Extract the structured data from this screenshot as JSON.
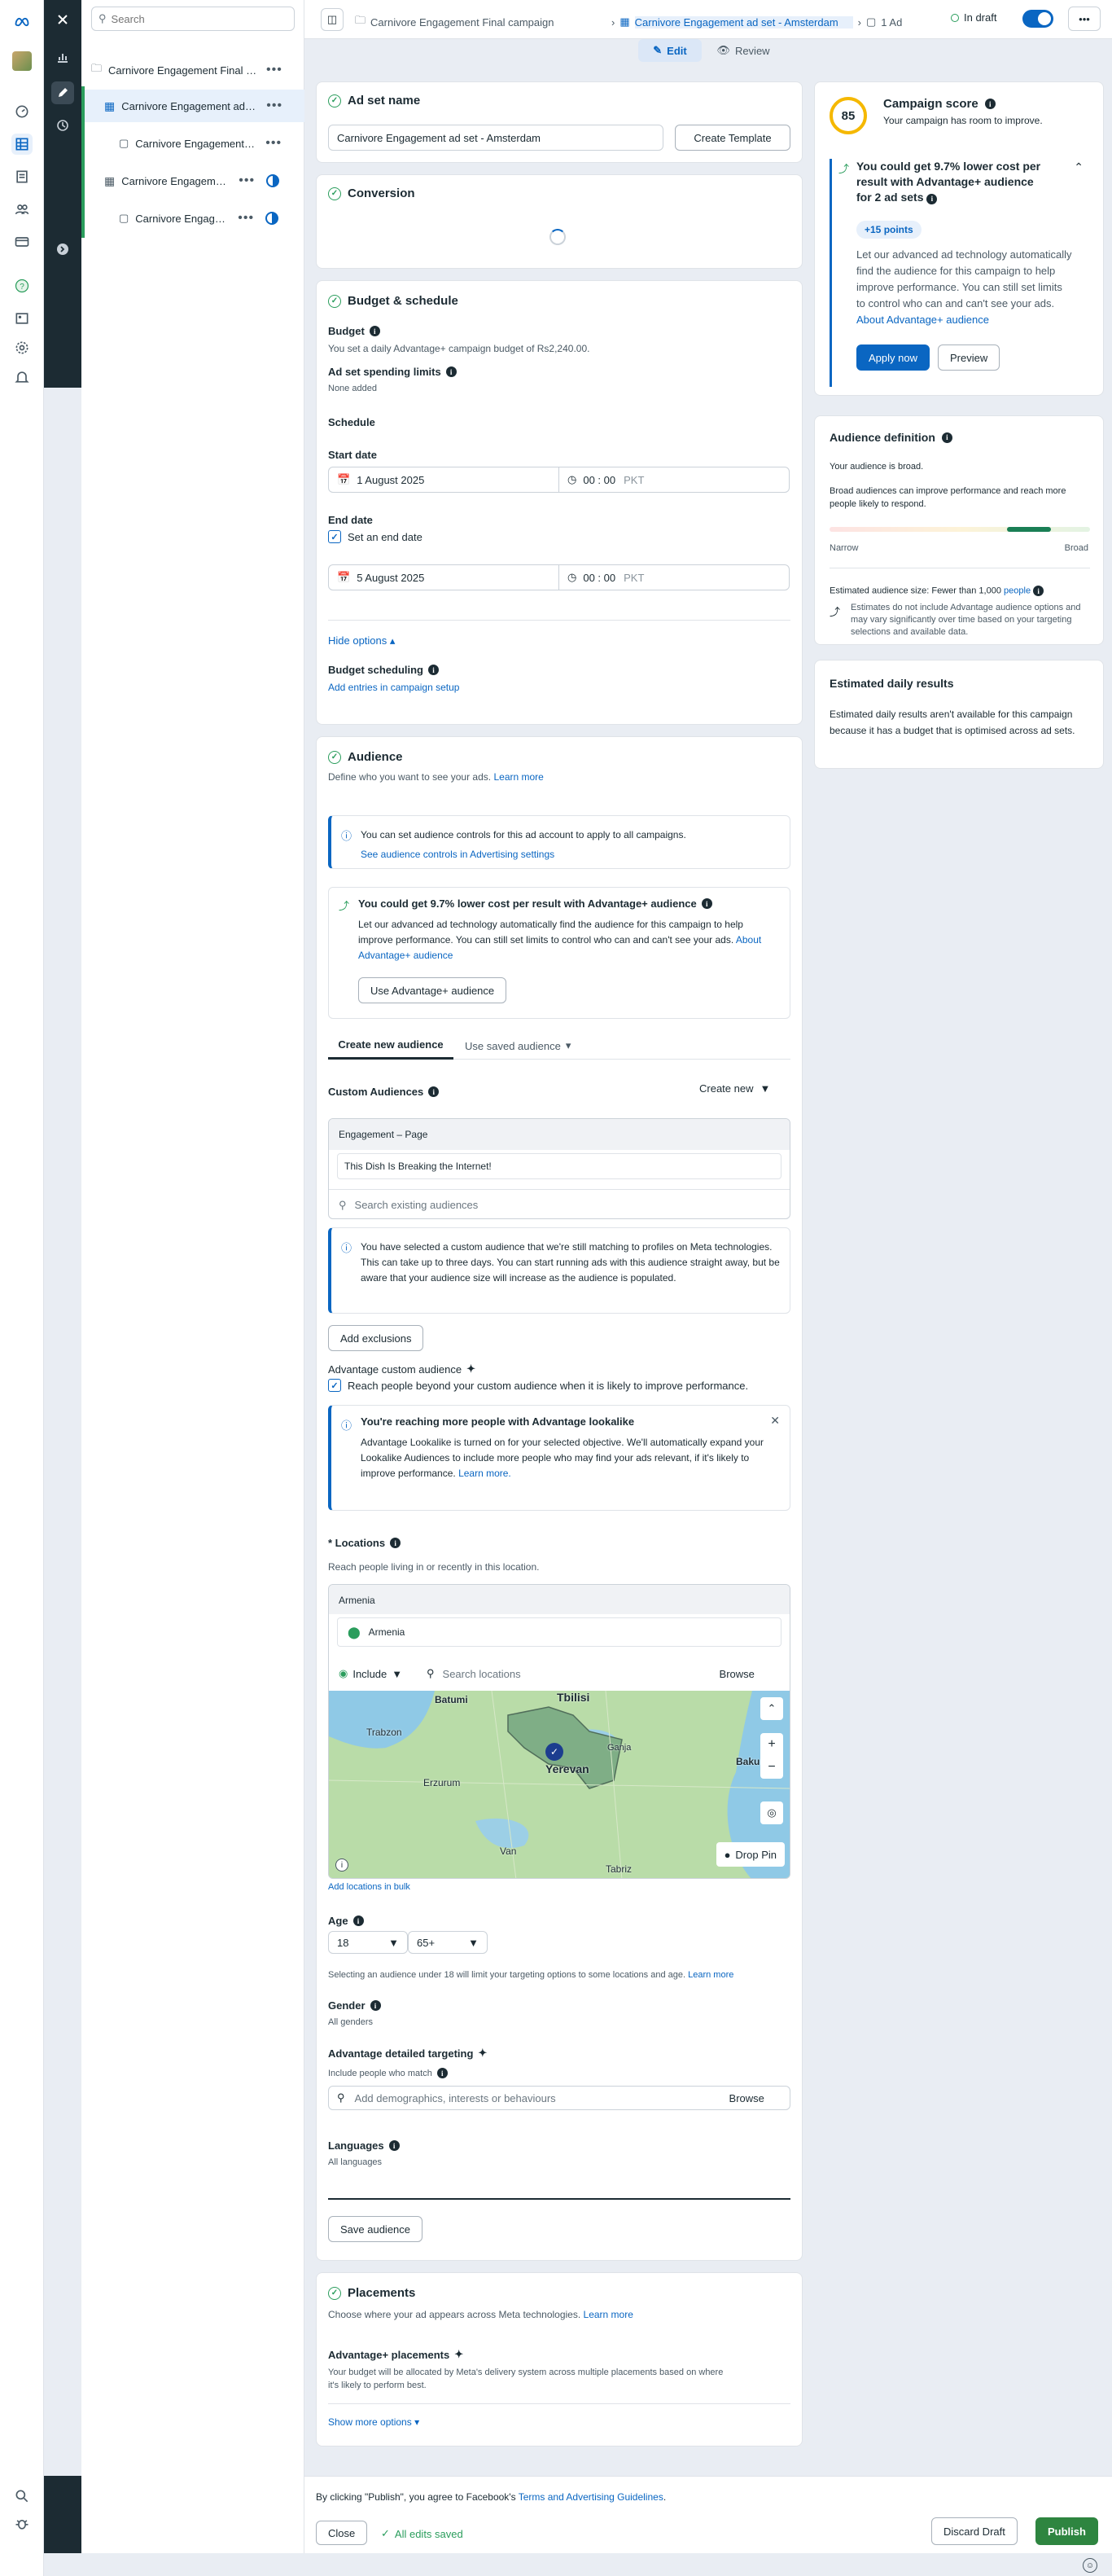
{
  "tree": {
    "search_placeholder": "Search",
    "campaign": "Carnivore Engagement Final campaign",
    "adset": "Carnivore Engagement ad set - Amsterdam",
    "ad1": "Carnivore Engagement ad",
    "adset2": "Carnivore Engagement ad set",
    "ad2": "Carnivore Engagement ad"
  },
  "topbar": {
    "crumb1": "Carnivore Engagement Final campaign",
    "crumb2": "Carnivore Engagement ad set - Amsterdam",
    "crumb3": "1 Ad",
    "status": "In draft",
    "edit": "Edit",
    "review": "Review"
  },
  "adset_name": {
    "title": "Ad set name",
    "value": "Carnivore Engagement ad set - Amsterdam",
    "create_template": "Create Template"
  },
  "conversion": {
    "title": "Conversion"
  },
  "budget": {
    "title": "Budget & schedule",
    "budget_label": "Budget",
    "budget_text": "You set a daily Advantage+ campaign budget of Rs2,240.00.",
    "spending_label": "Ad set spending limits",
    "spending_value": "None added",
    "schedule": "Schedule",
    "start_label": "Start date",
    "start_date": "1 August 2025",
    "start_time": "00 : 00",
    "tz": "PKT",
    "end_label": "End date",
    "set_end": "Set an end date",
    "end_date": "5 August 2025",
    "end_time": "00 : 00",
    "hide_options": "Hide options",
    "sched_label": "Budget scheduling",
    "sched_link": "Add entries in campaign setup"
  },
  "audience": {
    "title": "Audience",
    "subtitle": "Define who you want to see your ads.",
    "learn_more": "Learn more",
    "controls_info": "You can set audience controls for this ad account to apply to all campaigns.",
    "controls_link": "See audience controls in Advertising settings",
    "adv_title": "You could get 9.7% lower cost per result with Advantage+ audience",
    "adv_body": "Let our advanced ad technology automatically find the audience for this campaign to help improve performance. You can still set limits to control who can and can't see your ads.",
    "adv_link": "About Advantage+ audience",
    "use_adv": "Use Advantage+ audience",
    "tab1": "Create new audience",
    "tab2": "Use saved audience",
    "custom_label": "Custom Audiences",
    "create_new": "Create new",
    "eng_header": "Engagement – Page",
    "eng_item": "This Dish Is Breaking the Internet!",
    "search_existing": "Search existing audiences",
    "matching_info": "You have selected a custom audience that we're still matching to profiles on Meta technologies. This can take up to three days. You can start running ads with this audience straight away, but be aware that your audience size will increase as the audience is populated.",
    "add_exclusions": "Add exclusions",
    "adv_custom": "Advantage custom audience",
    "reach_beyond": "Reach people beyond your custom audience when it is likely to improve performance.",
    "lookalike_title": "You're reaching more people with Advantage lookalike",
    "lookalike_body": "Advantage Lookalike is turned on for your selected objective. We'll automatically expand your Lookalike Audiences to include more people who may find your ads relevant, if it's likely to improve performance.",
    "lookalike_link": "Learn more.",
    "locations_label": "* Locations",
    "locations_sub": "Reach people living in or recently in this location.",
    "loc_header": "Armenia",
    "loc_item": "Armenia",
    "include": "Include",
    "search_locations": "Search locations",
    "browse": "Browse",
    "drop_pin": "Drop Pin",
    "map_labels": [
      "Tbilisi",
      "Batumi",
      "Trabzon",
      "Ganja",
      "Yerevan",
      "Erzurum",
      "Van",
      "Tabriz",
      "Baku"
    ],
    "add_bulk": "Add locations in bulk",
    "age_label": "Age",
    "age_min": "18",
    "age_max": "65+",
    "age_note": "Selecting an audience under 18 will limit your targeting options to some locations and age.",
    "gender_label": "Gender",
    "gender_value": "All genders",
    "detailed_label": "Advantage detailed targeting",
    "include_match": "Include people who match",
    "detailed_placeholder": "Add demographics, interests or behaviours",
    "languages_label": "Languages",
    "languages_value": "All languages",
    "save_audience": "Save audience"
  },
  "placements": {
    "title": "Placements",
    "subtitle": "Choose where your ad appears across Meta technologies.",
    "learn_more": "Learn more",
    "adv_label": "Advantage+ placements",
    "adv_body": "Your budget will be allocated by Meta's delivery system across multiple placements based on where it's likely to perform best.",
    "show_more": "Show more options"
  },
  "score": {
    "value": "85",
    "title": "Campaign score",
    "subtitle": "Your campaign has room to improve.",
    "rec_title": "You could get 9.7% lower cost per result with Advantage+ audience for 2 ad sets",
    "points": "+15 points",
    "rec_body": "Let our advanced ad technology automatically find the audience for this campaign to help improve performance. You can still set limits to control who can and can't see your ads.",
    "rec_link": "About Advantage+ audience",
    "apply": "Apply now",
    "preview": "Preview"
  },
  "audience_def": {
    "title": "Audience definition",
    "broad_text": "Your audience is broad.",
    "broad_note": "Broad audiences can improve performance and reach more people likely to respond.",
    "narrow": "Narrow",
    "broad": "Broad",
    "level": 0.85,
    "size_text": "Estimated audience size: Fewer than 1,000",
    "size_link": "people",
    "est_note": "Estimates do not include Advantage audience options and may vary significantly over time based on your targeting selections and available data."
  },
  "daily": {
    "title": "Estimated daily results",
    "body": "Estimated daily results aren't available for this campaign because it has a budget that is optimised across ad sets."
  },
  "footer": {
    "agree": "By clicking \"Publish\", you agree to Facebook's",
    "terms": "Terms and Advertising Guidelines",
    "close": "Close",
    "saved": "All edits saved",
    "discard": "Discard Draft",
    "publish": "Publish"
  },
  "colors": {
    "accent": "#0a66c2",
    "publish": "#2e8540",
    "dark_rail": "#1c2b33"
  }
}
